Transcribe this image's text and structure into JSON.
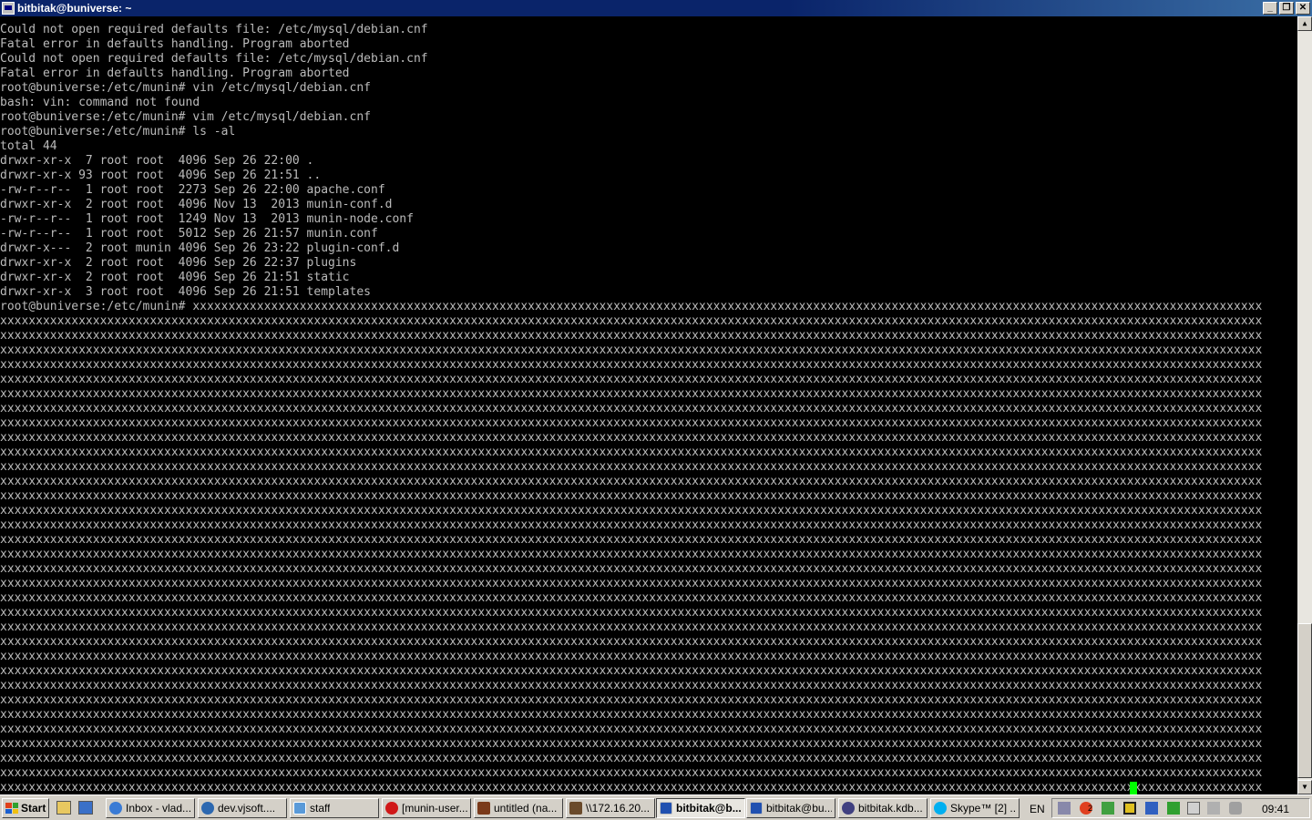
{
  "window": {
    "title": "bitbitak@buniverse: ~",
    "controls": [
      "minimize",
      "restore",
      "close"
    ]
  },
  "terminal": {
    "lines": [
      "Could not open required defaults file: /etc/mysql/debian.cnf",
      "Fatal error in defaults handling. Program aborted",
      "Could not open required defaults file: /etc/mysql/debian.cnf",
      "Fatal error in defaults handling. Program aborted",
      "root@buniverse:/etc/munin# vin /etc/mysql/debian.cnf",
      "bash: vin: command not found",
      "root@buniverse:/etc/munin# vim /etc/mysql/debian.cnf",
      "root@buniverse:/etc/munin# ls -al",
      "total 44",
      "drwxr-xr-x  7 root root  4096 Sep 26 22:00 .",
      "drwxr-xr-x 93 root root  4096 Sep 26 21:51 ..",
      "-rw-r--r--  1 root root  2273 Sep 26 22:00 apache.conf",
      "drwxr-xr-x  2 root root  4096 Nov 13  2013 munin-conf.d",
      "-rw-r--r--  1 root root  1249 Nov 13  2013 munin-node.conf",
      "-rw-r--r--  1 root root  5012 Sep 26 21:57 munin.conf",
      "drwxr-x---  2 root munin 4096 Sep 26 23:22 plugin-conf.d",
      "drwxr-xr-x  2 root root  4096 Sep 26 22:37 plugins",
      "drwxr-xr-x  2 root root  4096 Sep 26 21:51 static",
      "drwxr-xr-x  3 root root  4096 Sep 26 21:51 templates"
    ],
    "prompt": "root@buniverse:/etc/munin# ",
    "fill_char": "x",
    "cols": 177,
    "fill_rows": 33,
    "last_row_length": 155,
    "cursor_color": "#00ff00",
    "text_color": "#bbbbbb"
  },
  "taskbar": {
    "start_label": "Start",
    "quick_launch": [
      "folder-icon",
      "desktop-icon"
    ],
    "tasks": [
      {
        "label": "Inbox - vlad...",
        "icon": "browser-icon",
        "active": false
      },
      {
        "label": "dev.vjsoft....",
        "icon": "globe-icon",
        "active": false
      },
      {
        "label": "staff",
        "icon": "chat-icon",
        "active": false
      },
      {
        "label": "[munin-user...",
        "icon": "opera-icon",
        "active": false
      },
      {
        "label": "untitled (na...",
        "icon": "app-icon",
        "active": false
      },
      {
        "label": "\\\\172.16.20...",
        "icon": "remote-desktop-icon",
        "active": false
      },
      {
        "label": "bitbitak@b...",
        "icon": "putty-icon",
        "active": true
      },
      {
        "label": "bitbitak@bu...",
        "icon": "putty-icon",
        "active": false
      },
      {
        "label": "bitbitak.kdb...",
        "icon": "keepass-icon",
        "active": false
      },
      {
        "label": "Skype™ [2] ...",
        "icon": "skype-icon",
        "active": false
      }
    ],
    "language": "EN",
    "tray_badge": "2",
    "clock": "09:41"
  }
}
